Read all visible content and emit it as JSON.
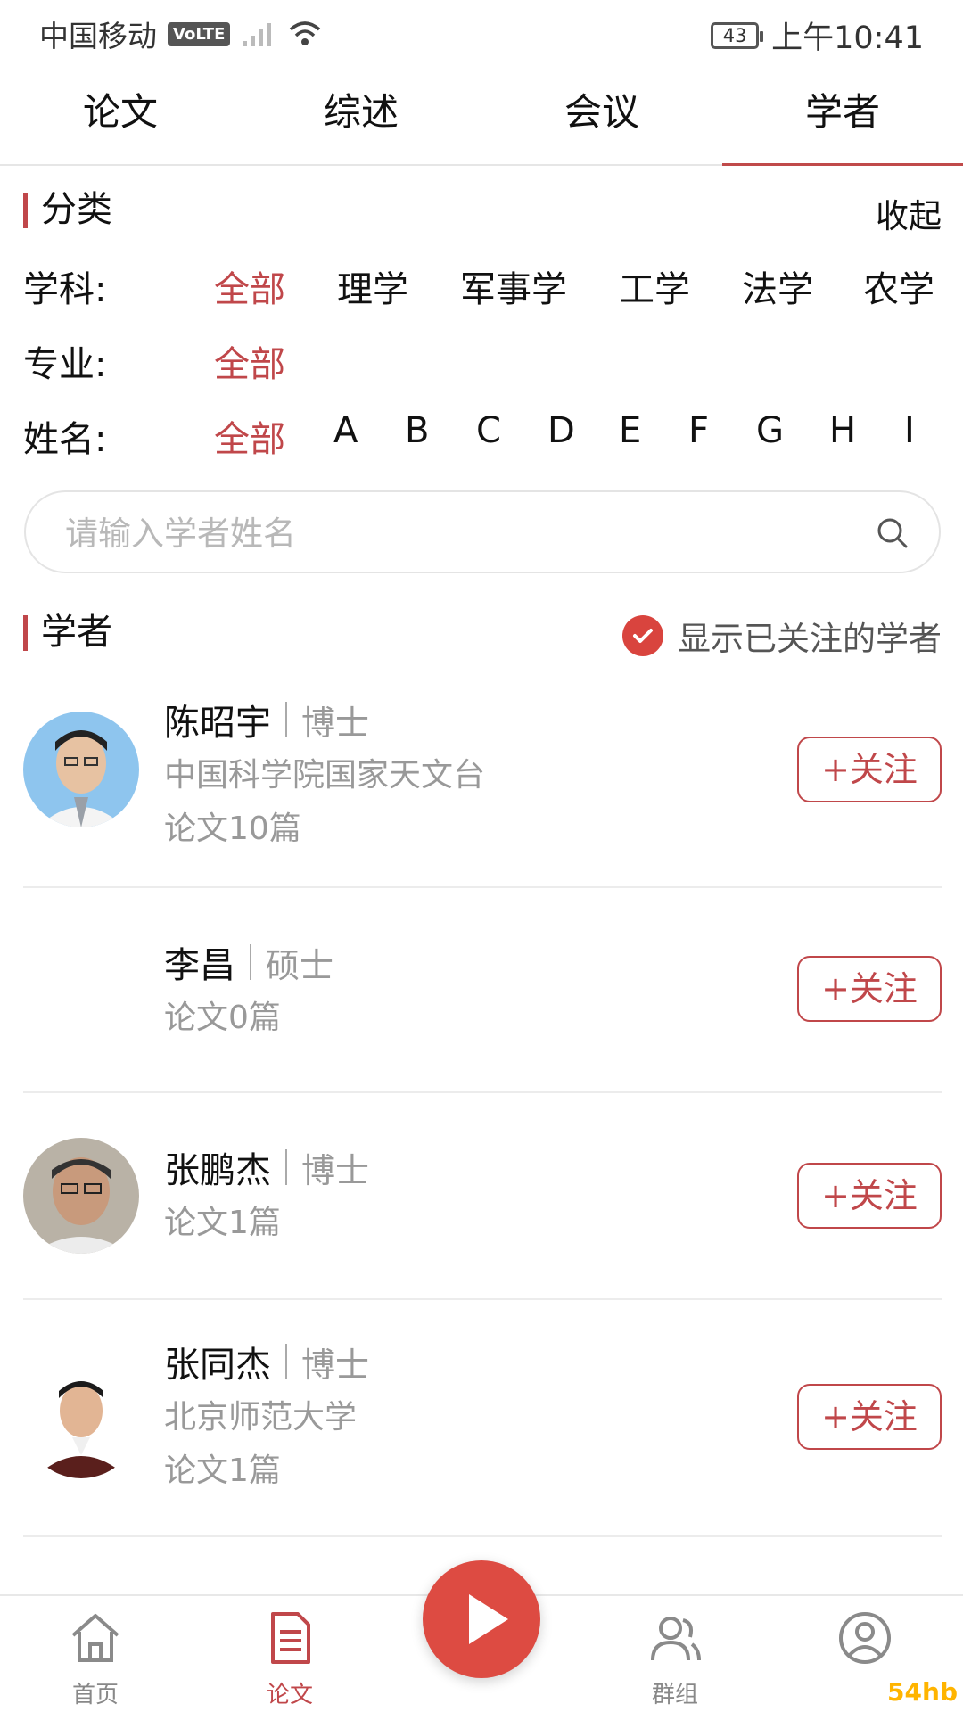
{
  "status": {
    "carrier": "中国移动",
    "volte": "VoLTE",
    "battery": "43",
    "time": "上午10:41"
  },
  "tabs": [
    "论文",
    "综述",
    "会议",
    "学者"
  ],
  "active_tab": "学者",
  "category": {
    "title": "分类",
    "collapse": "收起",
    "subject_label": "学科:",
    "subject_options": [
      "全部",
      "理学",
      "军事学",
      "工学",
      "法学",
      "农学"
    ],
    "major_label": "专业:",
    "major_options": [
      "全部"
    ],
    "name_label": "姓名:",
    "name_options": [
      "全部",
      "A",
      "B",
      "C",
      "D",
      "E",
      "F",
      "G",
      "H",
      "I"
    ]
  },
  "search": {
    "placeholder": "请输入学者姓名",
    "value": ""
  },
  "scholars_section": {
    "title": "学者",
    "toggle_label": "显示已关注的学者",
    "toggle_checked": true
  },
  "scholars": [
    {
      "name": "陈昭宇",
      "degree": "博士",
      "org": "中国科学院国家天文台",
      "papers": "论文10篇",
      "follow": "+关注"
    },
    {
      "name": "李昌",
      "degree": "硕士",
      "org": "",
      "papers": "论文0篇",
      "follow": "+关注"
    },
    {
      "name": "张鹏杰",
      "degree": "博士",
      "org": "",
      "papers": "论文1篇",
      "follow": "+关注"
    },
    {
      "name": "张同杰",
      "degree": "博士",
      "org": "北京师范大学",
      "papers": "论文1篇",
      "follow": "+关注"
    }
  ],
  "bottom_nav": [
    {
      "label": "首页",
      "icon": "home-icon"
    },
    {
      "label": "论文",
      "icon": "document-icon"
    },
    {
      "label": "群组",
      "icon": "group-icon"
    },
    {
      "label": "",
      "icon": "user-icon"
    }
  ],
  "watermark": "54hb",
  "colors": {
    "accent": "#c0474a",
    "fab": "#dd4b42",
    "muted_text": "#999999"
  }
}
